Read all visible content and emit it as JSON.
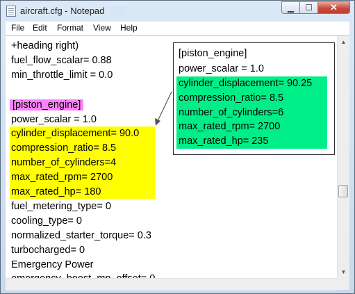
{
  "window": {
    "title": "aircraft.cfg - Notepad",
    "controls": {
      "minimize": "▁",
      "maximize": "☐",
      "close": "✕"
    }
  },
  "menubar": {
    "items": [
      "File",
      "Edit",
      "Format",
      "View",
      "Help"
    ]
  },
  "editor": {
    "lines": [
      "+heading right)",
      "fuel_flow_scalar= 0.88",
      "min_throttle_limit = 0.0",
      "",
      "[piston_engine]",
      "power_scalar = 1.0",
      "cylinder_displacement= 90.0",
      "compression_ratio= 8.5",
      "number_of_cylinders=4",
      "max_rated_rpm= 2700",
      "max_rated_hp= 180",
      "fuel_metering_type= 0",
      "cooling_type= 0",
      "normalized_starter_torque= 0.3",
      "turbocharged= 0",
      "Emergency Power",
      "emergency_boost_mp_offset= 0"
    ]
  },
  "popup": {
    "lines": [
      "[piston_engine]",
      "power_scalar = 1.0",
      "cylinder_displacement= 90.25",
      "compression_ratio= 8.5",
      "number_of_cylinders=6",
      "max_rated_rpm= 2700",
      "max_rated_hp= 235"
    ]
  },
  "colors": {
    "section_highlight": "#ff80ff",
    "original_values_highlight": "#ffff00",
    "new_values_highlight": "#00ee88"
  }
}
